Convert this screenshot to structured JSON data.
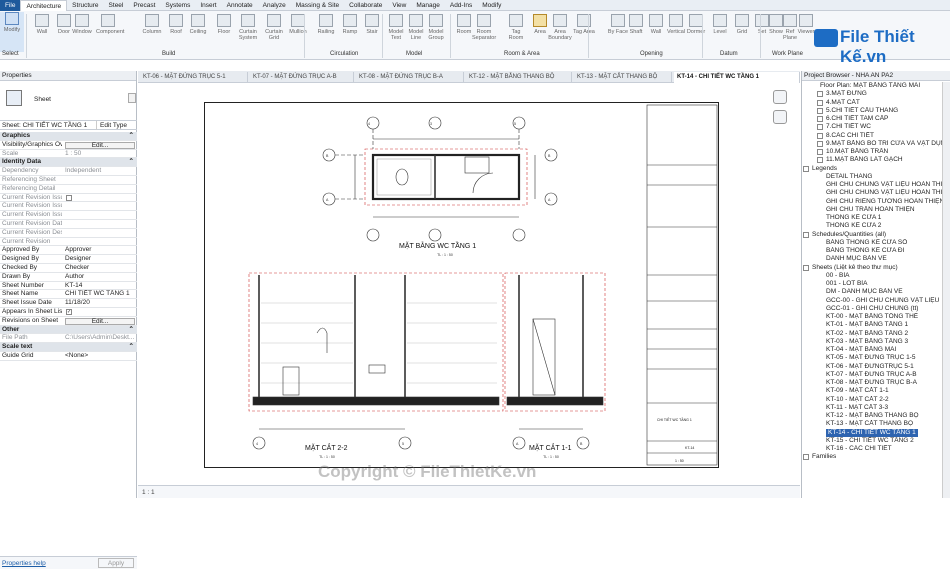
{
  "menu_tabs": [
    "File",
    "Architecture",
    "Structure",
    "Steel",
    "Precast",
    "Systems",
    "Insert",
    "Annotate",
    "Analyze",
    "Massing & Site",
    "Collaborate",
    "View",
    "Manage",
    "Add-Ins",
    "Modify"
  ],
  "active_tab": "Architecture",
  "ribbon": {
    "tools": [
      "Modify",
      "Wall",
      "Door",
      "Window",
      "Component",
      "Column",
      "Roof",
      "Ceiling",
      "Floor",
      "Curtain System",
      "Curtain Grid",
      "Mullion",
      "Railing",
      "Ramp",
      "Stair",
      "Model Text",
      "Model Line",
      "Model Group",
      "Room",
      "Room Separator",
      "Tag Room",
      "Area",
      "Area Boundary",
      "Tag Area",
      "By Face",
      "Shaft",
      "Wall",
      "Vertical",
      "Dormer",
      "Level",
      "Grid",
      "Set",
      "Show",
      "Ref Plane",
      "Viewer"
    ],
    "groups": [
      "Select",
      "Build",
      "Circulation",
      "Model",
      "Room & Area",
      "Opening",
      "Datum",
      "Work Plane"
    ]
  },
  "logo": {
    "text": "File Thiết Kế.vn"
  },
  "properties": {
    "title": "Properties",
    "type_name": "Sheet",
    "selector": "Sheet: CHI TIẾT WC TẦNG 1",
    "edit_type": "Edit Type",
    "rows": [
      {
        "k": "Graphics",
        "v": "",
        "kind": "h"
      },
      {
        "k": "Visibility/Graphics Ov...",
        "v": "Edit...",
        "kind": "btn"
      },
      {
        "k": "Scale",
        "v": "1 : 50",
        "kind": "g"
      },
      {
        "k": "Identity Data",
        "v": "",
        "kind": "h"
      },
      {
        "k": "Dependency",
        "v": "Independent",
        "kind": "g"
      },
      {
        "k": "Referencing Sheet",
        "v": "",
        "kind": "g"
      },
      {
        "k": "Referencing Detail",
        "v": "",
        "kind": "g"
      },
      {
        "k": "Current Revision Issued",
        "v": "",
        "kind": "gcb"
      },
      {
        "k": "Current Revision Issu...",
        "v": "",
        "kind": "g"
      },
      {
        "k": "Current Revision Issu...",
        "v": "",
        "kind": "g"
      },
      {
        "k": "Current Revision Date",
        "v": "",
        "kind": "g"
      },
      {
        "k": "Current Revision Desc...",
        "v": "",
        "kind": "g"
      },
      {
        "k": "Current Revision",
        "v": "",
        "kind": "g"
      },
      {
        "k": "Approved By",
        "v": "Approver",
        "kind": ""
      },
      {
        "k": "Designed By",
        "v": "Designer",
        "kind": ""
      },
      {
        "k": "Checked By",
        "v": "Checker",
        "kind": ""
      },
      {
        "k": "Drawn By",
        "v": "Author",
        "kind": ""
      },
      {
        "k": "Sheet Number",
        "v": "KT-14",
        "kind": ""
      },
      {
        "k": "Sheet Name",
        "v": "CHI TIẾT WC TẦNG 1",
        "kind": ""
      },
      {
        "k": "Sheet Issue Date",
        "v": "11/18/20",
        "kind": ""
      },
      {
        "k": "Appears In Sheet List",
        "v": "",
        "kind": "cb"
      },
      {
        "k": "Revisions on Sheet",
        "v": "Edit...",
        "kind": "btn"
      },
      {
        "k": "Other",
        "v": "",
        "kind": "h"
      },
      {
        "k": "File Path",
        "v": "C:\\Users\\Admin\\Deskt...",
        "kind": "g"
      },
      {
        "k": "Scale text",
        "v": "",
        "kind": "h"
      },
      {
        "k": "Guide Grid",
        "v": "<None>",
        "kind": ""
      }
    ],
    "help": "Properties help",
    "apply": "Apply"
  },
  "view_tabs": [
    {
      "label": "KT-06 - MẶT ĐỨNG TRỤC 5-1",
      "active": false
    },
    {
      "label": "KT-07 - MẶT ĐỨNG TRỤC A-B",
      "active": false
    },
    {
      "label": "KT-08 - MẶT ĐỨNG TRỤC B-A",
      "active": false
    },
    {
      "label": "KT-12 - MẶT BẰNG THANG BỘ",
      "active": false
    },
    {
      "label": "KT-13 - MẶT CẮT THANG BỘ",
      "active": false
    },
    {
      "label": "KT-14 - CHI TIẾT WC TẦNG 1",
      "active": true
    }
  ],
  "drawing": {
    "plan_title": "MẶT BẰNG WC TẦNG 1",
    "plan_scale": "TL : 1 : 50",
    "section22_title": "MẶT CẮT 2-2",
    "section22_scale": "TL : 1 : 50",
    "section11_title": "MẶT CẮT 1-1",
    "section11_scale": "TL : 1 : 50",
    "title_block": {
      "sheet_name": "CHI TIẾT WC TẦNG 1",
      "sheet_number": "KT-14",
      "scale": "1 : 50"
    }
  },
  "browser": {
    "title": "Project Browser - NHA AN PA2",
    "items": [
      {
        "t": "Floor Plan: MẶT BẰNG TẦNG MÁI",
        "lvl": 3,
        "box": false
      },
      {
        "t": "3.MẶT ĐỨNG",
        "lvl": 2,
        "box": true
      },
      {
        "t": "4.MẶT CẮT",
        "lvl": 2,
        "box": true
      },
      {
        "t": "5.CHI TIẾT CẦU THANG",
        "lvl": 2,
        "box": true
      },
      {
        "t": "6.CHI TIẾT TAM CẤP",
        "lvl": 2,
        "box": true
      },
      {
        "t": "7.CHI TIẾT WC",
        "lvl": 2,
        "box": true
      },
      {
        "t": "8.CÁC CHI TIẾT",
        "lvl": 2,
        "box": true
      },
      {
        "t": "9.MẶT BẰNG BỐ TRÍ CỬA VÀ VẬT DỤNG",
        "lvl": 2,
        "box": true
      },
      {
        "t": "10.MẶT BẰNG TRẦN",
        "lvl": 2,
        "box": true
      },
      {
        "t": "11.MẶT BẰNG LÁT GẠCH",
        "lvl": 2,
        "box": true
      },
      {
        "t": "Legends",
        "lvl": 1,
        "box": true
      },
      {
        "t": "DETAIL THANG",
        "lvl": 2,
        "box": false
      },
      {
        "t": "GHI CHÚ CHUNG VẬT LIỆU HOÀN THIỆN",
        "lvl": 2,
        "box": false
      },
      {
        "t": "GHI CHÚ CHUNG VẬT LIỆU HOÀN THIỆN (tt)",
        "lvl": 2,
        "box": false
      },
      {
        "t": "GHI CHÚ RIÊNG TƯỜNG HOÀN THIỆN",
        "lvl": 2,
        "box": false
      },
      {
        "t": "GHI CHÚ TRẦN HOÀN THIỆN",
        "lvl": 2,
        "box": false
      },
      {
        "t": "THỐNG KÊ CỬA 1",
        "lvl": 2,
        "box": false
      },
      {
        "t": "THỐNG KÊ CỬA 2",
        "lvl": 2,
        "box": false
      },
      {
        "t": "Schedules/Quantities (all)",
        "lvl": 1,
        "box": true
      },
      {
        "t": "BẢNG THỐNG KÊ CỬA SỔ",
        "lvl": 2,
        "box": false
      },
      {
        "t": "BẢNG THỐNG KÊ CỬA ĐI",
        "lvl": 2,
        "box": false
      },
      {
        "t": "DANH MỤC BẢN VẼ",
        "lvl": 2,
        "box": false
      },
      {
        "t": "Sheets (Liệt kê theo thư mục)",
        "lvl": 1,
        "box": true
      },
      {
        "t": "00 - BÌA",
        "lvl": 2,
        "box": false
      },
      {
        "t": "001 - LÓT BÌA",
        "lvl": 2,
        "box": false
      },
      {
        "t": "DM - DANH MỤC BẢN VẼ",
        "lvl": 2,
        "box": false
      },
      {
        "t": "GCC-00 - GHI CHÚ CHUNG VẬT LIỆU",
        "lvl": 2,
        "box": false
      },
      {
        "t": "GCC-01 - GHI CHÚ CHUNG (tt)",
        "lvl": 2,
        "box": false
      },
      {
        "t": "KT-00 - MẶT BẰNG TỔNG THỂ",
        "lvl": 2,
        "box": false
      },
      {
        "t": "KT-01 - MẶT BẰNG TẦNG 1",
        "lvl": 2,
        "box": false
      },
      {
        "t": "KT-02 - MẶT BẰNG TẦNG 2",
        "lvl": 2,
        "box": false
      },
      {
        "t": "KT-03 - MẶT BẰNG TẦNG 3",
        "lvl": 2,
        "box": false
      },
      {
        "t": "KT-04 - MẶT BẰNG MÁI",
        "lvl": 2,
        "box": false
      },
      {
        "t": "KT-05 - MẶT ĐỨNG TRỤC 1-5",
        "lvl": 2,
        "box": false
      },
      {
        "t": "KT-06 - MẶT ĐỨNGTRỤC 5-1",
        "lvl": 2,
        "box": false
      },
      {
        "t": "KT-07 - MẶT ĐỨNG TRỤC A-B",
        "lvl": 2,
        "box": false
      },
      {
        "t": "KT-08 - MẶT ĐỨNG TRỤC B-A",
        "lvl": 2,
        "box": false
      },
      {
        "t": "KT-09 - MẶT CẮT 1-1",
        "lvl": 2,
        "box": false
      },
      {
        "t": "KT-10 - MẶT CẮT 2-2",
        "lvl": 2,
        "box": false
      },
      {
        "t": "KT-11 - MẶT CẮT 3-3",
        "lvl": 2,
        "box": false
      },
      {
        "t": "KT-12 - MẶT BẰNG THANG BỘ",
        "lvl": 2,
        "box": false
      },
      {
        "t": "KT-13 - MẶT CẮT THANG BỘ",
        "lvl": 2,
        "box": false
      },
      {
        "t": "KT-14 - CHI TIẾT WC TẦNG 1",
        "lvl": 2,
        "box": false,
        "sel": true
      },
      {
        "t": "KT-15 - CHI TIẾT WC TẦNG 2",
        "lvl": 2,
        "box": false
      },
      {
        "t": "KT-16 - CÁC CHI TIẾT",
        "lvl": 2,
        "box": false
      },
      {
        "t": "Families",
        "lvl": 1,
        "box": true
      }
    ]
  },
  "status": {
    "scale": "1 : 1"
  },
  "watermark": "Copyright © FileThietKe.vn"
}
